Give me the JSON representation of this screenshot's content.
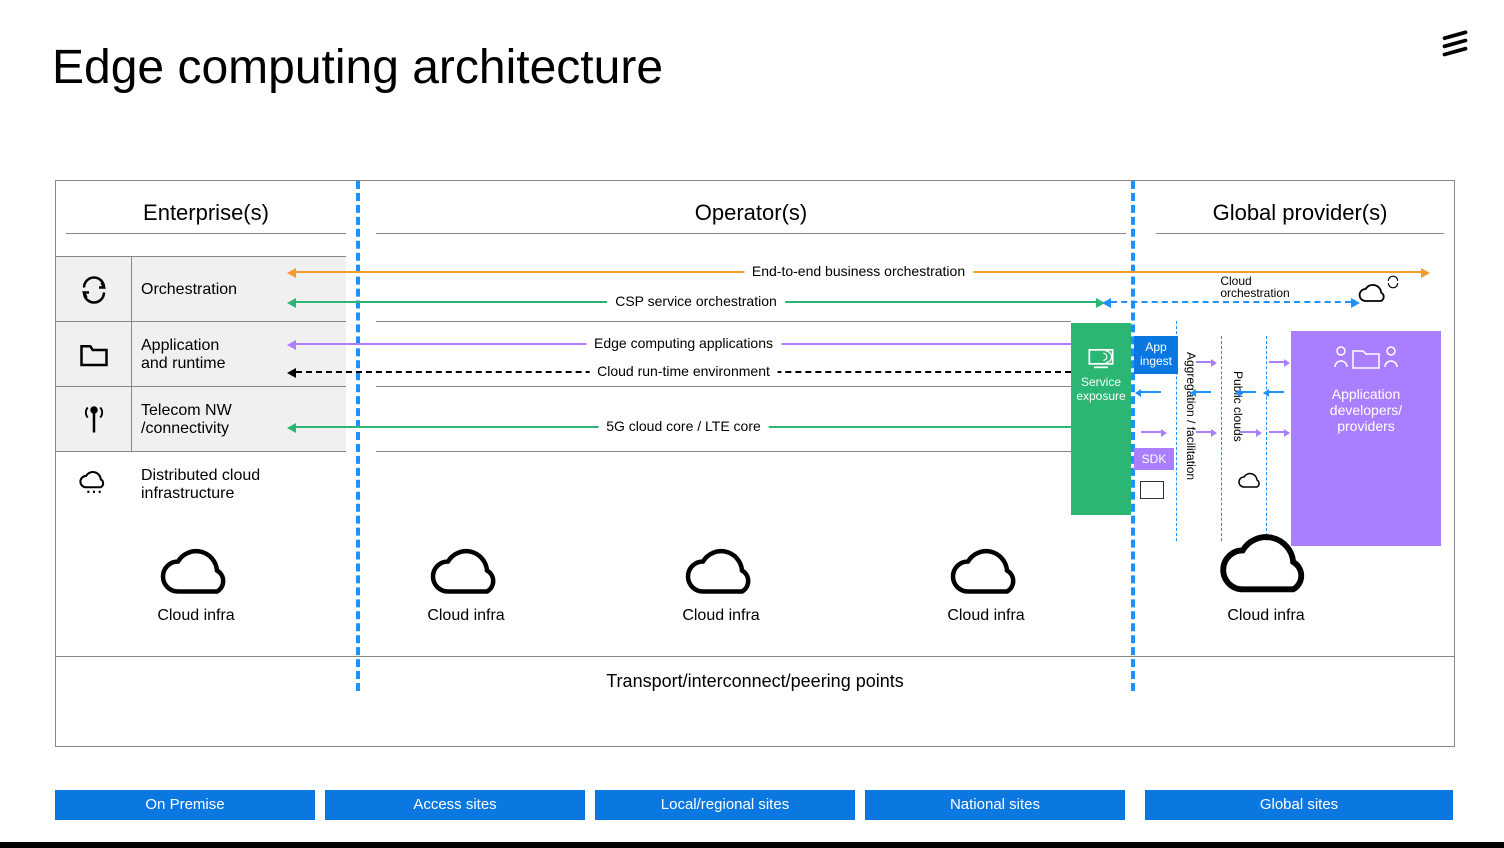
{
  "title": "Edge computing architecture",
  "columns": {
    "enterprise": "Enterprise(s)",
    "operator": "Operator(s)",
    "global": "Global provider(s)"
  },
  "rows": {
    "orchestration": "Orchestration",
    "app_runtime_l1": "Application",
    "app_runtime_l2": "and runtime",
    "telecom_l1": "Telecom NW",
    "telecom_l2": "/connectivity",
    "dist_cloud_l1": "Distributed cloud",
    "dist_cloud_l2": "infrastructure"
  },
  "arrows": {
    "e2e": "End-to-end business orchestration",
    "csp": "CSP service orchestration",
    "cloud_orch": "Cloud\norchestration",
    "edge_apps": "Edge computing applications",
    "cloud_rte": "Cloud run-time environment",
    "core": "5G cloud core / LTE core"
  },
  "boxes": {
    "service_exposure": "Service\nexposure",
    "app_ingest": "App\ningest",
    "sdk": "SDK",
    "agg": "Aggregation / facilitation",
    "public_clouds": "Public clouds",
    "app_dev": "Application\ndevelopers/\nproviders"
  },
  "cloud_label": "Cloud infra",
  "transport": "Transport/interconnect/peering points",
  "footer": {
    "onprem": "On Premise",
    "access": "Access sites",
    "local": "Local/regional sites",
    "national": "National sites",
    "global": "Global sites"
  },
  "colors": {
    "orange": "#f59b2c",
    "green": "#2bb673",
    "purple": "#a97fff",
    "black": "#000",
    "blue": "#0a78e0",
    "dashblue": "#1e90ff"
  }
}
